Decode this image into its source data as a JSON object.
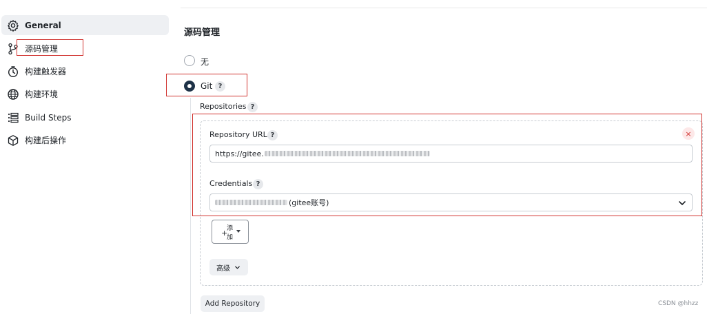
{
  "sidebar": {
    "items": [
      {
        "label": "General",
        "icon": "gear-icon"
      },
      {
        "label": "源码管理",
        "icon": "branch-icon"
      },
      {
        "label": "构建触发器",
        "icon": "timer-icon"
      },
      {
        "label": "构建环境",
        "icon": "globe-icon"
      },
      {
        "label": "Build Steps",
        "icon": "list-icon"
      },
      {
        "label": "构建后操作",
        "icon": "cube-icon"
      }
    ]
  },
  "scm": {
    "title": "源码管理",
    "option_none": "无",
    "option_git": "Git",
    "help": "?",
    "repositories_label": "Repositories",
    "repository_url_label": "Repository URL",
    "repository_url_value": "https://gitee.",
    "credentials_label": "Credentials",
    "credentials_suffix": "(gitee账号)",
    "close_symbol": "×",
    "add_plus": "+",
    "add_line1": "添",
    "add_line2": "加",
    "advanced_label": "高级",
    "add_repository_label": "Add Repository"
  },
  "watermark": "CSDN @hhzz",
  "colors": {
    "annotation_red": "#d0312d",
    "radio_checked": "#1e3247",
    "sidebar_active": "#eef0f3"
  }
}
